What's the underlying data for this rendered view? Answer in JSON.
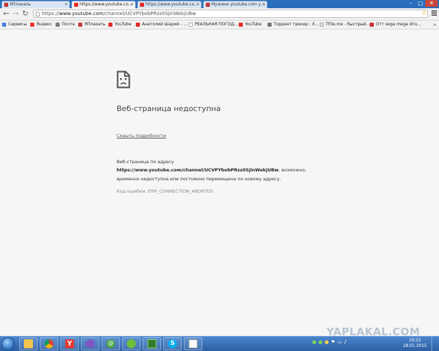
{
  "tabs": [
    {
      "label": "ЯПлакаль",
      "fav": "#c23a3a",
      "active": false
    },
    {
      "label": "https://www.youtube.co...",
      "fav": "#e52d27",
      "active": true
    },
    {
      "label": "https://www.youtube.co...",
      "fav": "#e52d27",
      "active": false
    },
    {
      "label": "Мужики youtube.com у...",
      "fav": "#c23a3a",
      "active": false
    }
  ],
  "window_controls": {
    "minimize": "–",
    "maximize": "□",
    "close": "✕"
  },
  "toolbar": {
    "back": "←",
    "forward": "→",
    "reload": "↻",
    "url_prefix": "https://",
    "url_host": "www.youtube.com",
    "url_path": "/channel/UCVPYbobPRzz0SjinWekjUBw",
    "star": "☆"
  },
  "bookmarks": [
    {
      "label": "Сервисы",
      "fav": "#4a7fd6"
    },
    {
      "label": "Яндекс",
      "fav": "#e33"
    },
    {
      "label": "Почта",
      "fav": "#7a7a7a"
    },
    {
      "label": "ЯПлакать",
      "fav": "#c23a3a"
    },
    {
      "label": "YouTube",
      "fav": "#e52d27"
    },
    {
      "label": "Анатолий Шарий - ...",
      "fav": "#e52d27"
    },
    {
      "label": "РЕАЛЬНАЯ ПОГОД...",
      "fav": "#ffffff"
    },
    {
      "label": "YouTube",
      "fav": "#e52d27"
    },
    {
      "label": "Торрент трекер : Х...",
      "fav": "#777"
    },
    {
      "label": "TFile.me - быстрый...",
      "fav": "#dddddd"
    },
    {
      "label": "Отт sega mega driv...",
      "fav": "#c33"
    }
  ],
  "bookmarks_more": "»",
  "error": {
    "title": "Веб-страница недоступна",
    "details_link": "Скрыть подробности",
    "body_line1": "Веб-страница по адресу",
    "body_url": "https://www.youtube.com/channel/UCVPYbobPRzz0SjinWekjUBw",
    "body_after_url": ", возможно,",
    "body_line3": "временно недоступна или постоянно перемещена по новому адресу.",
    "code": "Код ошибки: ERR_CONNECTION_ABORTED"
  },
  "watermark": "YAPLAKAL.COM",
  "taskbar": {
    "apps": [
      {
        "name": "explorer",
        "color": "#f3c54b"
      },
      {
        "name": "chrome",
        "color": "#4caf50"
      },
      {
        "name": "yandex-browser",
        "color": "#e53935"
      },
      {
        "name": "visual-studio",
        "color": "#7e57c2"
      },
      {
        "name": "icq",
        "color": "#43a047"
      },
      {
        "name": "utorrent",
        "color": "#6fbf3b"
      },
      {
        "name": "cmd",
        "color": "#2e7d32"
      },
      {
        "name": "skype",
        "color": "#00aff0"
      },
      {
        "name": "paint",
        "color": "#ffffff"
      }
    ],
    "time": "19:23",
    "date": "28.01.2015"
  }
}
